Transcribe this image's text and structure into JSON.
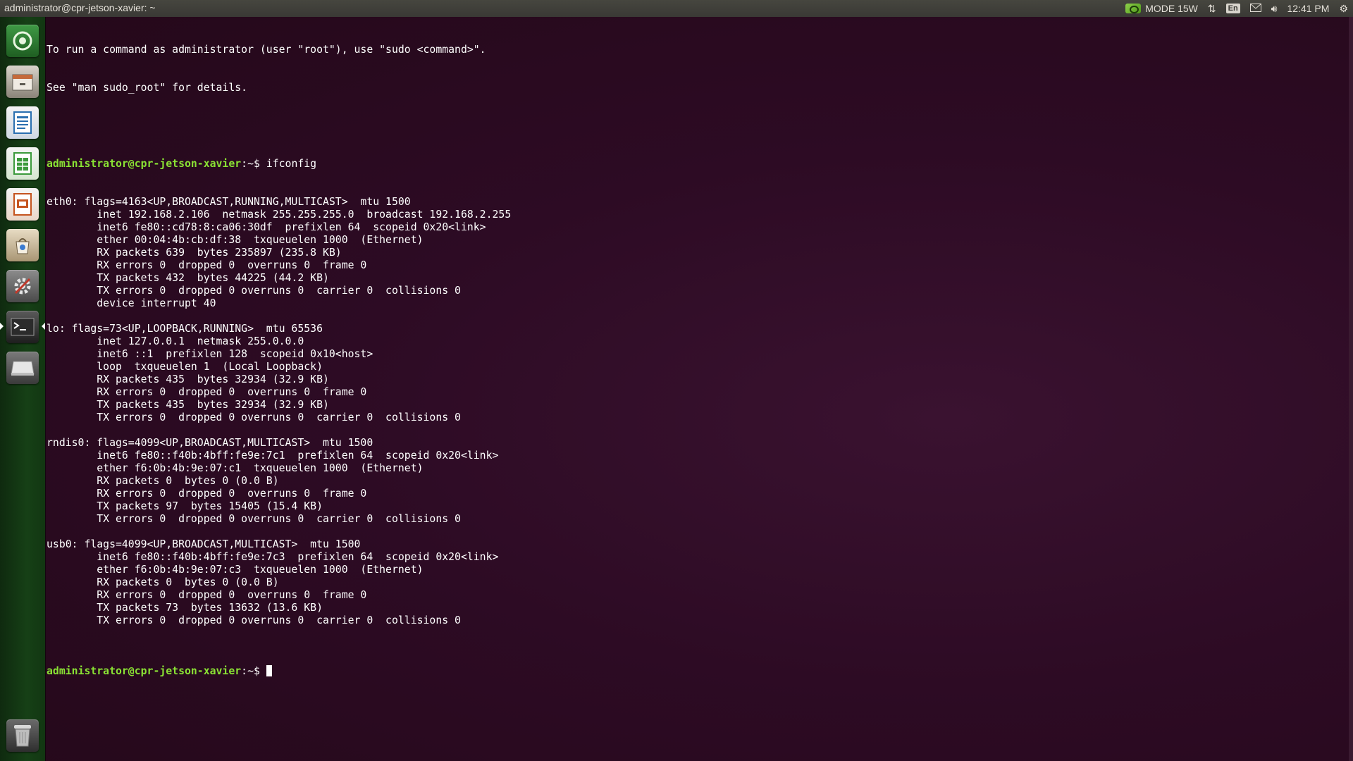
{
  "top_panel": {
    "window_title": "administrator@cpr-jetson-xavier: ~",
    "power_mode": "MODE 15W",
    "keyboard_layout": "En",
    "clock": "12:41 PM",
    "icons": [
      "nvidia-icon",
      "network-icon",
      "keyboard-icon",
      "mail-icon",
      "volume-icon",
      "settings-gear-icon"
    ]
  },
  "launcher": {
    "items": [
      {
        "name": "chromium-icon",
        "color": "#2e7d32"
      },
      {
        "name": "files-icon",
        "color": "#8a8378"
      },
      {
        "name": "libreoffice-writer-icon",
        "color": "#2a6fb0"
      },
      {
        "name": "libreoffice-calc-icon",
        "color": "#3c9a3c"
      },
      {
        "name": "libreoffice-impress-icon",
        "color": "#c5541f"
      },
      {
        "name": "software-center-icon",
        "color": "#c9b89a"
      },
      {
        "name": "system-settings-icon",
        "color": "#6b6b6b"
      },
      {
        "name": "terminal-icon",
        "color": "#2b2b2b"
      },
      {
        "name": "drive-icon",
        "color": "#bfbfbf"
      }
    ],
    "trash": {
      "name": "trash-icon"
    }
  },
  "terminal": {
    "prompt": "administrator@cpr-jetson-xavier",
    "prompt_suffix": ":~$ ",
    "command": "ifconfig",
    "intro": [
      "To run a command as administrator (user \"root\"), use \"sudo <command>\".",
      "See \"man sudo_root\" for details."
    ],
    "output": [
      "eth0: flags=4163<UP,BROADCAST,RUNNING,MULTICAST>  mtu 1500",
      "        inet 192.168.2.106  netmask 255.255.255.0  broadcast 192.168.2.255",
      "        inet6 fe80::cd78:8:ca06:30df  prefixlen 64  scopeid 0x20<link>",
      "        ether 00:04:4b:cb:df:38  txqueuelen 1000  (Ethernet)",
      "        RX packets 639  bytes 235897 (235.8 KB)",
      "        RX errors 0  dropped 0  overruns 0  frame 0",
      "        TX packets 432  bytes 44225 (44.2 KB)",
      "        TX errors 0  dropped 0 overruns 0  carrier 0  collisions 0",
      "        device interrupt 40",
      "",
      "lo: flags=73<UP,LOOPBACK,RUNNING>  mtu 65536",
      "        inet 127.0.0.1  netmask 255.0.0.0",
      "        inet6 ::1  prefixlen 128  scopeid 0x10<host>",
      "        loop  txqueuelen 1  (Local Loopback)",
      "        RX packets 435  bytes 32934 (32.9 KB)",
      "        RX errors 0  dropped 0  overruns 0  frame 0",
      "        TX packets 435  bytes 32934 (32.9 KB)",
      "        TX errors 0  dropped 0 overruns 0  carrier 0  collisions 0",
      "",
      "rndis0: flags=4099<UP,BROADCAST,MULTICAST>  mtu 1500",
      "        inet6 fe80::f40b:4bff:fe9e:7c1  prefixlen 64  scopeid 0x20<link>",
      "        ether f6:0b:4b:9e:07:c1  txqueuelen 1000  (Ethernet)",
      "        RX packets 0  bytes 0 (0.0 B)",
      "        RX errors 0  dropped 0  overruns 0  frame 0",
      "        TX packets 97  bytes 15405 (15.4 KB)",
      "        TX errors 0  dropped 0 overruns 0  carrier 0  collisions 0",
      "",
      "usb0: flags=4099<UP,BROADCAST,MULTICAST>  mtu 1500",
      "        inet6 fe80::f40b:4bff:fe9e:7c3  prefixlen 64  scopeid 0x20<link>",
      "        ether f6:0b:4b:9e:07:c3  txqueuelen 1000  (Ethernet)",
      "        RX packets 0  bytes 0 (0.0 B)",
      "        RX errors 0  dropped 0  overruns 0  frame 0",
      "        TX packets 73  bytes 13632 (13.6 KB)",
      "        TX errors 0  dropped 0 overruns 0  carrier 0  collisions 0",
      ""
    ],
    "colors": {
      "prompt": "#8ae234",
      "text": "#ffffff",
      "background": "#2c0a22"
    }
  }
}
